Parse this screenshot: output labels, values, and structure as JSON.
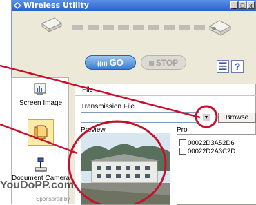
{
  "window": {
    "title": "Wireless Utility",
    "minimize": "_",
    "maximize": "□",
    "close": "x"
  },
  "controls": {
    "go_label": "GO",
    "go_signal": "((ı))",
    "stop_label": "STOP",
    "manual_label": "☰",
    "help_label": "?"
  },
  "sidebar": {
    "items": [
      {
        "label": "Screen Image"
      },
      {
        "label": "File"
      },
      {
        "label": "Document Camera"
      }
    ]
  },
  "file_panel": {
    "tab_label": "File",
    "transmission_label": "Transmission File",
    "transmission_value": "",
    "browse_label": "Browse",
    "preview_label": "Preview",
    "projector_label": "Projector",
    "projectors": [
      {
        "id": "00022D3A52D6",
        "checked": false
      },
      {
        "id": "00022D2A3C2D",
        "checked": false
      }
    ]
  },
  "watermark": {
    "text": "YouDoPP.com",
    "sponsor": "Sponsored by"
  },
  "colors": {
    "titlebar": "#2a5fd0",
    "go_button": "#3b7cd0",
    "annotation": "#c8102e"
  }
}
